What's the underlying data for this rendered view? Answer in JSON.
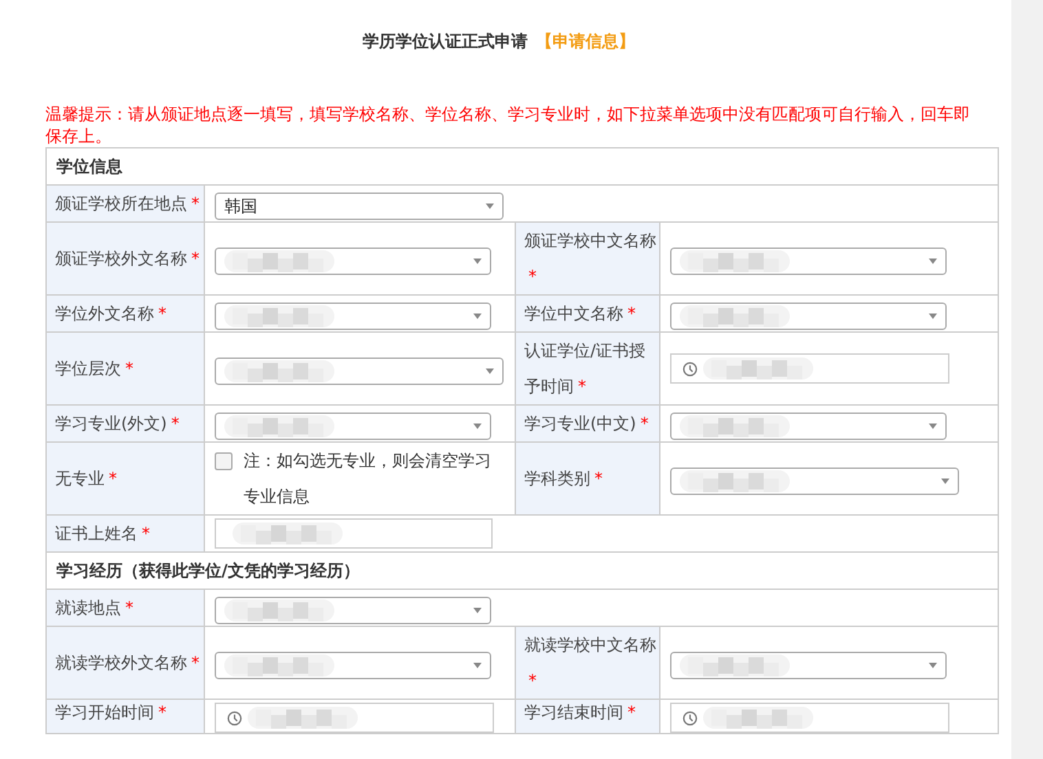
{
  "title": {
    "main": "学历学位认证正式申请",
    "tag": "【申请信息】"
  },
  "notice": "温馨提示：请从颁证地点逐一填写，填写学校名称、学位名称、学习专业时，如下拉菜单选项中没有匹配项可自行输入，回车即保存上。",
  "rows": [
    {
      "kind": "section",
      "title": "学位信息"
    },
    {
      "kind": "fields",
      "fields": [
        {
          "label": "颁证学校所在地点",
          "mark": "*",
          "control": {
            "kind": "select",
            "value": "韩国",
            "obscured": false
          }
        }
      ]
    },
    {
      "kind": "fields",
      "fields": [
        {
          "label": "颁证学校外文名称",
          "mark": "*",
          "control": {
            "kind": "select",
            "obscured": true
          }
        },
        {
          "label": "颁证学校中文名称",
          "mark": "*",
          "control": {
            "kind": "select",
            "obscured": true
          }
        }
      ]
    },
    {
      "kind": "fields",
      "fields": [
        {
          "label": "学位外文名称",
          "mark": "*",
          "control": {
            "kind": "select",
            "obscured": true
          }
        },
        {
          "label": "学位中文名称",
          "mark": "*",
          "control": {
            "kind": "select",
            "obscured": true
          }
        }
      ]
    },
    {
      "kind": "fields",
      "fields": [
        {
          "label": "学位层次",
          "mark": "*",
          "control": {
            "kind": "select",
            "obscured": true
          }
        },
        {
          "label": "认证学位/证书授予时间",
          "mark": "*",
          "control": {
            "kind": "date",
            "obscured": true
          }
        }
      ]
    },
    {
      "kind": "fields",
      "fields": [
        {
          "label": "学习专业(外文)",
          "mark": "*",
          "control": {
            "kind": "select",
            "obscured": true
          }
        },
        {
          "label": "学习专业(中文)",
          "mark": "*",
          "control": {
            "kind": "select",
            "obscured": true
          }
        }
      ]
    },
    {
      "kind": "fields",
      "fields": [
        {
          "label": "无专业",
          "mark": "*",
          "control": {
            "kind": "checkbox",
            "checked": false,
            "note": "注：如勾选无专业，则会清空学习专业信息"
          }
        },
        {
          "label": "学科类别",
          "mark": "*",
          "control": {
            "kind": "select",
            "obscured": true
          }
        }
      ]
    },
    {
      "kind": "fields",
      "fields": [
        {
          "label": "证书上姓名",
          "mark": "*",
          "control": {
            "kind": "text",
            "obscured": true
          }
        }
      ]
    },
    {
      "kind": "section",
      "title": "学习经历（获得此学位/文凭的学习经历）"
    },
    {
      "kind": "fields",
      "fields": [
        {
          "label": "就读地点",
          "mark": "*",
          "control": {
            "kind": "select",
            "obscured": true
          }
        }
      ]
    },
    {
      "kind": "fields",
      "fields": [
        {
          "label": "就读学校外文名称",
          "mark": "*",
          "control": {
            "kind": "select",
            "obscured": true
          }
        },
        {
          "label": "就读学校中文名称",
          "mark": "*",
          "control": {
            "kind": "select",
            "obscured": true
          }
        }
      ]
    },
    {
      "kind": "fields",
      "fields": [
        {
          "label": "学习开始时间",
          "mark": "*",
          "control": {
            "kind": "date",
            "obscured": true
          }
        },
        {
          "label": "学习结束时间",
          "mark": "*",
          "control": {
            "kind": "date",
            "obscured": true
          }
        }
      ]
    }
  ]
}
